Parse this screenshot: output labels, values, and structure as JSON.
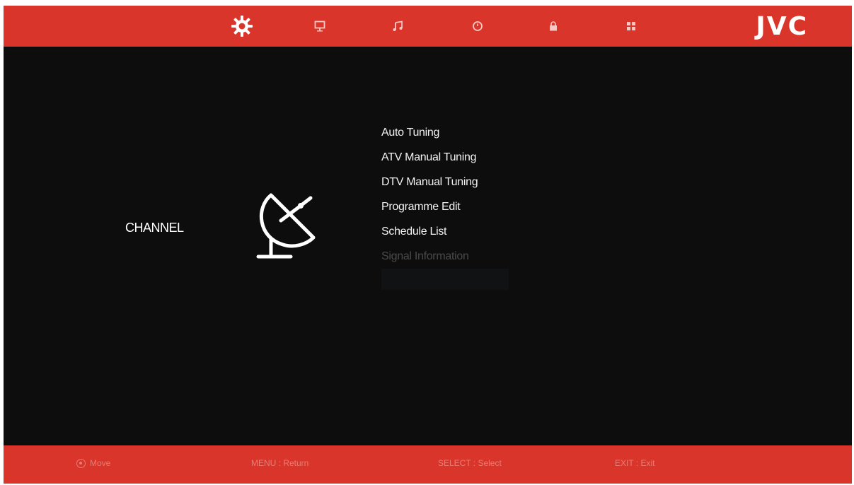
{
  "header": {
    "tabs": [
      {
        "name": "setup",
        "icon": "gear-icon",
        "active": true
      },
      {
        "name": "picture",
        "icon": "monitor-icon",
        "active": false
      },
      {
        "name": "sound",
        "icon": "music-note-icon",
        "active": false
      },
      {
        "name": "time",
        "icon": "clock-icon",
        "active": false
      },
      {
        "name": "lock",
        "icon": "lock-icon",
        "active": false
      },
      {
        "name": "apps",
        "icon": "grid-icon",
        "active": false
      }
    ],
    "brand": "JVC"
  },
  "main": {
    "category_label": "CHANNEL",
    "category_icon": "satellite-dish-icon",
    "menu_items": [
      {
        "label": "Auto Tuning",
        "enabled": true
      },
      {
        "label": "ATV Manual Tuning",
        "enabled": true
      },
      {
        "label": "DTV Manual Tuning",
        "enabled": true
      },
      {
        "label": "Programme Edit",
        "enabled": true
      },
      {
        "label": "Schedule List",
        "enabled": true
      },
      {
        "label": "Signal Information",
        "enabled": false
      }
    ]
  },
  "footer": {
    "hints": [
      {
        "icon": "dpad-icon",
        "text": "Move"
      },
      {
        "text": "MENU : Return"
      },
      {
        "text": "SELECT : Select"
      },
      {
        "text": "EXIT : Exit"
      }
    ]
  },
  "colors": {
    "bar": "#d9352a",
    "background": "#0d0d0d",
    "text": "#f2f2f2",
    "disabled_text": "#4a4a4a",
    "hint_text": "#e97d74"
  }
}
